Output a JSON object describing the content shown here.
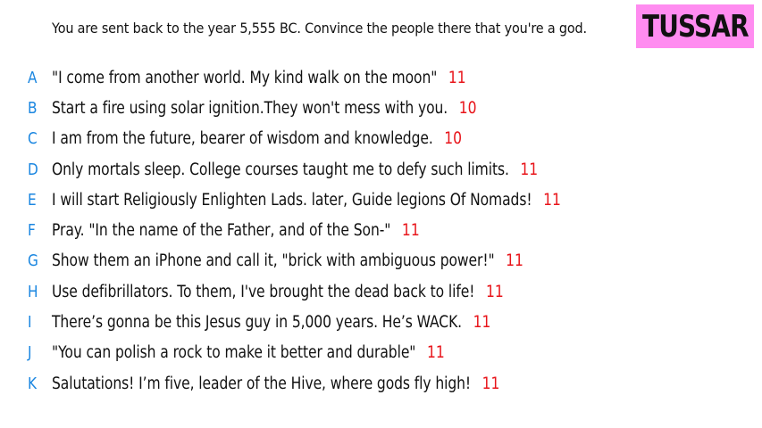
{
  "prompt": "You are sent back to the year 5,555 BC. Convince the people there that you're a god.",
  "logo": "TUSSAR",
  "colors": {
    "letter": "#1a86e0",
    "score": "#e8141a",
    "logo_bg": "#ff8cf0"
  },
  "answers": [
    {
      "letter": "A",
      "text": "\"I come from another world. My kind walk on the moon\"",
      "score": "11"
    },
    {
      "letter": "B",
      "text": "Start a fire using solar ignition.They won't mess with you.",
      "score": "10"
    },
    {
      "letter": "C",
      "text": "I am from the future, bearer of wisdom and knowledge.",
      "score": "10"
    },
    {
      "letter": "D",
      "text": "Only mortals sleep. College courses taught me to defy such limits.",
      "score": "11"
    },
    {
      "letter": "E",
      "text": "I will start Religiously Enlighten Lads. later, Guide legions Of Nomads!",
      "score": "11"
    },
    {
      "letter": "F",
      "text": "Pray. \"In the name of the Father, and of the Son-\"",
      "score": "11"
    },
    {
      "letter": "G",
      "text": "Show them an iPhone and call it, \"brick with ambiguous power!\"",
      "score": "11"
    },
    {
      "letter": "H",
      "text": "Use defibrillators. To them, I've brought the dead back to life!",
      "score": "11"
    },
    {
      "letter": "I",
      "text": "There’s gonna be this Jesus guy in 5,000 years. He’s WACK.",
      "score": "11"
    },
    {
      "letter": "J",
      "text": "\"You can polish a rock to make it better and durable\"",
      "score": "11"
    },
    {
      "letter": "K",
      "text": "Salutations! I’m five, leader of the Hive, where gods fly high!",
      "score": "11"
    }
  ]
}
